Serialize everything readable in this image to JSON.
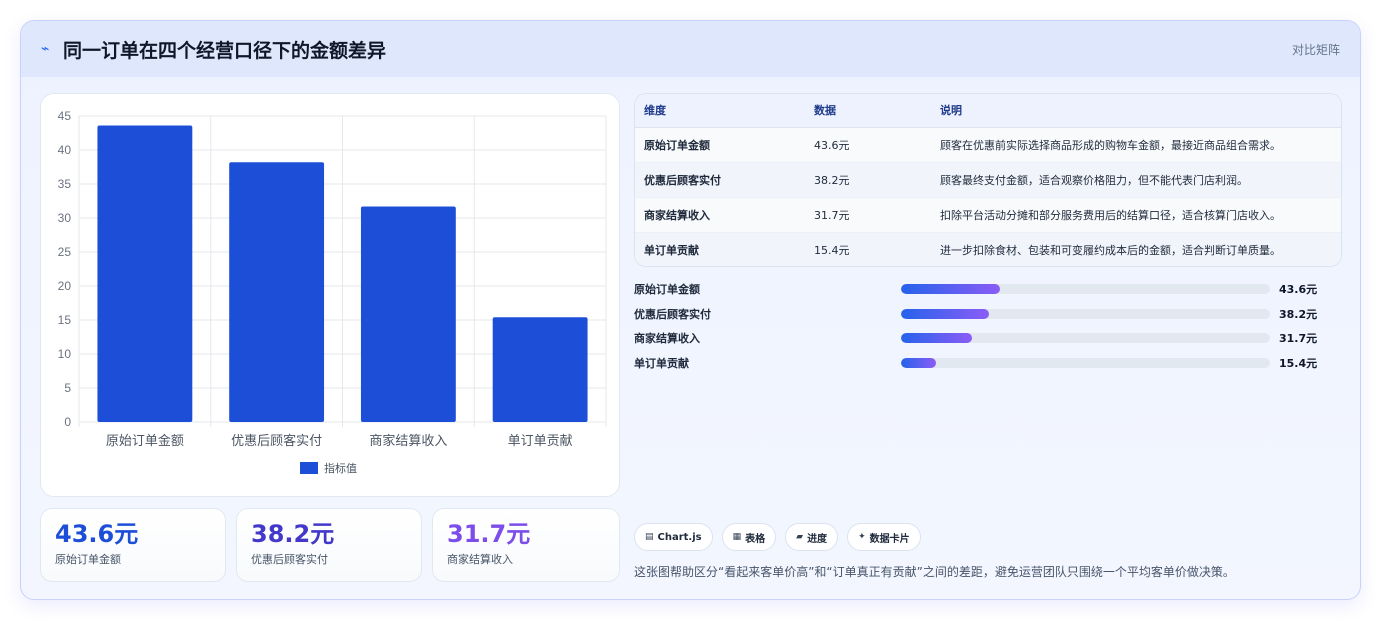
{
  "header": {
    "title": "同一订单在四个经营口径下的金额差异",
    "title_icon": "trend-line-icon",
    "badge": "对比矩阵"
  },
  "chart_data": {
    "type": "bar",
    "categories": [
      "原始订单金额",
      "优惠后顾客实付",
      "商家结算收入",
      "单订单贡献"
    ],
    "series": [
      {
        "name": "指标值",
        "values": [
          43.6,
          38.2,
          31.7,
          15.4
        ],
        "color": "#1d4ed8"
      }
    ],
    "yticks": [
      0,
      5,
      10,
      15,
      20,
      25,
      30,
      35,
      40,
      45
    ],
    "ylim": [
      0,
      45
    ],
    "grid": true,
    "legend": "bottom"
  },
  "stats": [
    {
      "value": "43.6元",
      "label": "原始订单金额",
      "color": "#1d4ed8"
    },
    {
      "value": "38.2元",
      "label": "优惠后顾客实付",
      "color": "#4338ca"
    },
    {
      "value": "31.7元",
      "label": "商家结算收入",
      "color": "#7c4dea"
    }
  ],
  "table": {
    "headers": [
      "维度",
      "数据",
      "说明"
    ],
    "rows": [
      [
        "原始订单金额",
        "43.6元",
        "顾客在优惠前实际选择商品形成的购物车金额，最接近商品组合需求。"
      ],
      [
        "优惠后顾客实付",
        "38.2元",
        "顾客最终支付金额，适合观察价格阻力，但不能代表门店利润。"
      ],
      [
        "商家结算收入",
        "31.7元",
        "扣除平台活动分摊和部分服务费用后的结算口径，适合核算门店收入。"
      ],
      [
        "单订单贡献",
        "15.4元",
        "进一步扣除食材、包装和可变履约成本后的金额，适合判断订单质量。"
      ]
    ]
  },
  "progress": [
    {
      "label": "原始订单金额",
      "value": "43.6元",
      "fraction": 0.268
    },
    {
      "label": "优惠后顾客实付",
      "value": "38.2元",
      "fraction": 0.238
    },
    {
      "label": "商家结算收入",
      "value": "31.7元",
      "fraction": 0.193
    },
    {
      "label": "单订单贡献",
      "value": "15.4元",
      "fraction": 0.095
    }
  ],
  "chips": [
    {
      "icon": "chart-icon",
      "glyph": "▤",
      "label": "Chart.js"
    },
    {
      "icon": "table-icon",
      "glyph": "▦",
      "label": "表格"
    },
    {
      "icon": "progress-icon",
      "glyph": "▰",
      "label": "进度"
    },
    {
      "icon": "card-icon",
      "glyph": "✦",
      "label": "数据卡片"
    }
  ],
  "note": "这张图帮助区分“看起来客单价高”和“订单真正有贡献”之间的差距，避免运营团队只围绕一个平均客单价做决策。"
}
